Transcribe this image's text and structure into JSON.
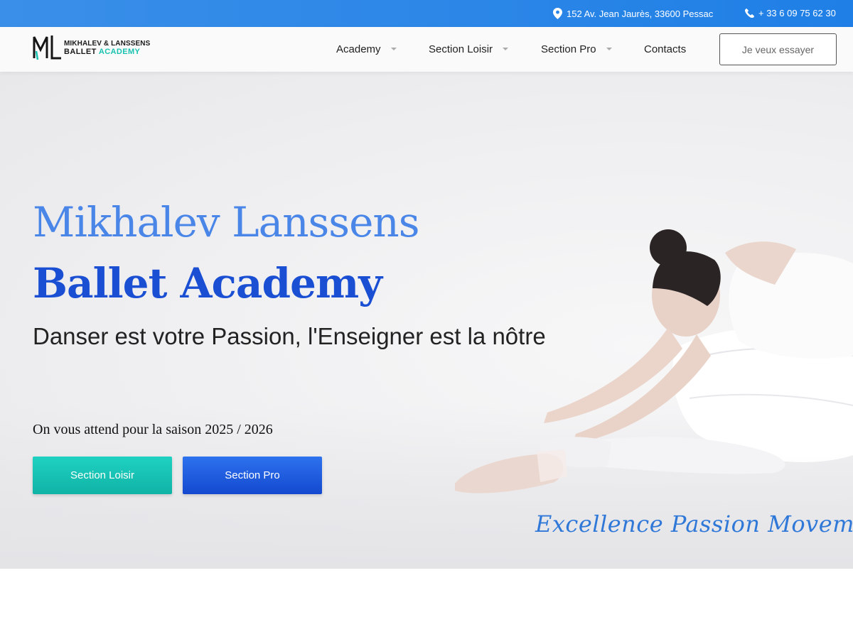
{
  "topbar": {
    "address": "152 Av. Jean Jaurès, 33600 Pessac",
    "phone": "+ 33 6 09 75 62 30",
    "address_icon": "map-pin-icon",
    "phone_icon": "phone-icon"
  },
  "header": {
    "logo": {
      "line1": "MIKHALEV & LANSSENS",
      "line2a": "BALLET",
      "line2b": "ACADEMY"
    },
    "nav": [
      {
        "label": "Academy",
        "has_dropdown": true
      },
      {
        "label": "Section Loisir",
        "has_dropdown": true
      },
      {
        "label": "Section Pro",
        "has_dropdown": true
      },
      {
        "label": "Contacts",
        "has_dropdown": false
      }
    ],
    "cta_label": "Je veux essayer"
  },
  "hero": {
    "title_line1": "Mikhalev Lanssens",
    "title_line2": "Ballet Academy",
    "subtitle": "Danser est votre Passion, l'Enseigner est la nôtre",
    "season": "On vous attend pour la saison 2025 / 2026",
    "buttons": [
      {
        "label": "Section Loisir"
      },
      {
        "label": "Section Pro"
      }
    ],
    "tagline": "Excellence Passion Movement"
  },
  "colors": {
    "topbar": "#1f7fe6",
    "title_light": "#4a86e8",
    "title_dark": "#1a4fd4",
    "teal": "#10b3a6",
    "blue_button": "#1449cf"
  }
}
